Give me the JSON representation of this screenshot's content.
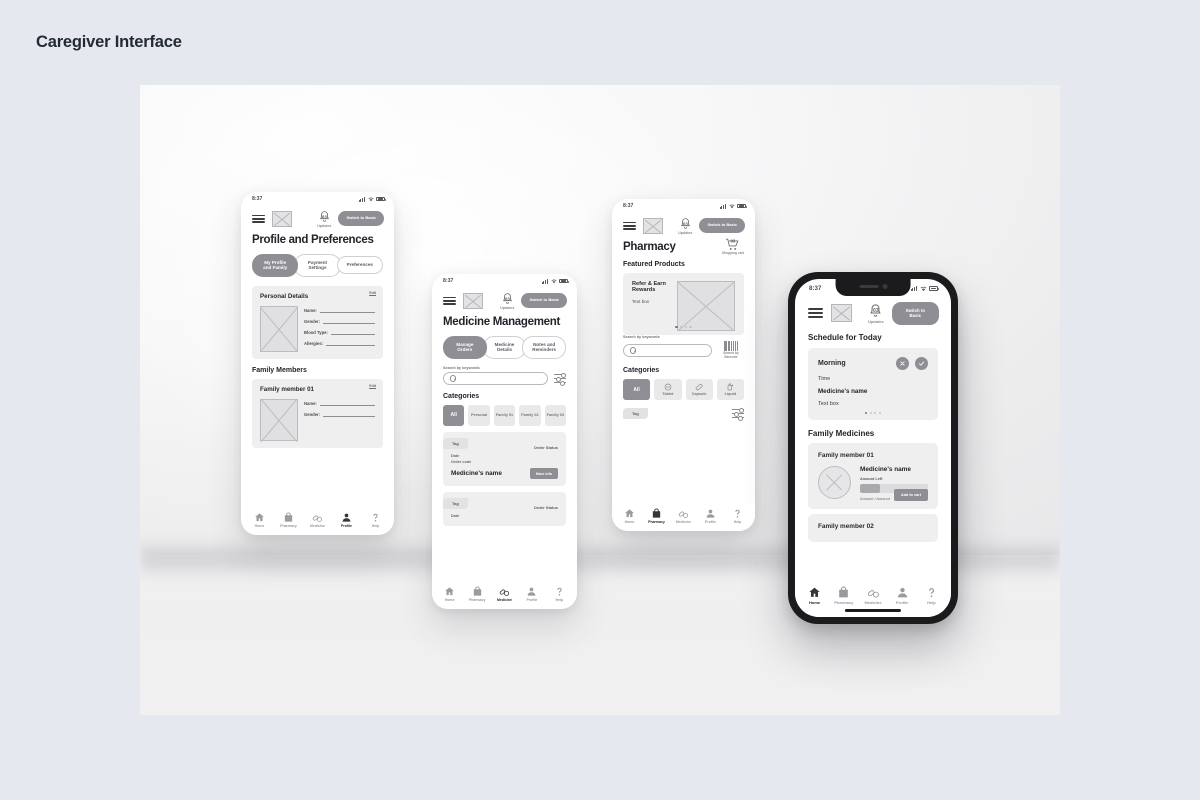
{
  "page": {
    "title": "Caregiver Interface"
  },
  "common": {
    "status_time": "8:37",
    "updates_label": "Updates",
    "updates_badge": "03",
    "switch_button": "Switch to Basic",
    "nav": [
      {
        "label": "Home",
        "icon": "home-icon"
      },
      {
        "label": "Pharmacy",
        "icon": "bag-icon"
      },
      {
        "label": "Medicine",
        "icon": "pills-icon"
      },
      {
        "label": "Profile",
        "icon": "person-icon"
      },
      {
        "label": "Help",
        "icon": "question-icon"
      }
    ],
    "edit_link": "Edit"
  },
  "screen1": {
    "title": "Profile and Preferences",
    "tabs": [
      {
        "label": "My Profile and Family",
        "active": true
      },
      {
        "label": "Payment Settings",
        "active": false
      },
      {
        "label": "Preferences",
        "active": false
      }
    ],
    "personal_details": {
      "title": "Personal Details",
      "fields": [
        "Name:",
        "Gender:",
        "Blood Type:",
        "Allergies:"
      ]
    },
    "family_members_heading": "Family Members",
    "family_card": {
      "title": "Family member 01",
      "fields": [
        "Name:",
        "Gender:"
      ]
    },
    "active_nav": "Profile"
  },
  "screen2": {
    "title": "Medicine Management",
    "tabs": [
      {
        "label": "Manage Orders",
        "active": true
      },
      {
        "label": "Medicine Details",
        "active": false
      },
      {
        "label": "Notes and Reminders",
        "active": false
      }
    ],
    "search_label": "Search by keywords",
    "search_placeholder": "",
    "categories_heading": "Categories",
    "categories": [
      {
        "label": "All",
        "active": true
      },
      {
        "label": "Personal",
        "active": false
      },
      {
        "label": "Family 01",
        "active": false
      },
      {
        "label": "Family 02",
        "active": false
      },
      {
        "label": "Family 03",
        "active": false
      }
    ],
    "orders": [
      {
        "tag": "Tag",
        "status": "Order Status",
        "date": "Date",
        "code": "Order code",
        "name": "Medicine's name",
        "button": "More info"
      },
      {
        "tag": "Tag",
        "status": "Order Status",
        "date": "Date",
        "code": "",
        "name": "",
        "button": ""
      }
    ],
    "active_nav": "Medicine"
  },
  "screen3": {
    "title": "Pharmacy",
    "cart_label": "Shopping cart",
    "cart_badge": "03",
    "featured_heading": "Featured Products",
    "featured": {
      "title": "Refer & Earn Rewards",
      "subtitle": "Text box",
      "dots": 4,
      "active_dot": 0
    },
    "search_label": "Search by keywords",
    "barcode_label": "Search by Barcode",
    "categories_heading": "Categories",
    "categories": [
      {
        "label": "All",
        "active": true,
        "icon": "none"
      },
      {
        "label": "Tablet",
        "active": false,
        "icon": "tablet-icon"
      },
      {
        "label": "Capsule",
        "active": false,
        "icon": "capsule-icon"
      },
      {
        "label": "Liquid",
        "active": false,
        "icon": "bottle-icon"
      }
    ],
    "list_tag": "Tag",
    "active_nav": "Pharmacy"
  },
  "screen4": {
    "title": "Schedule for Today",
    "schedule": {
      "period": "Morning",
      "time": "Time",
      "medicine": "Medicine's name",
      "note": "Text box",
      "dots": 4,
      "active_dot": 0,
      "dismiss_icon": "close-icon",
      "confirm_icon": "check-icon"
    },
    "family_medicines_heading": "Family Medicines",
    "members": [
      {
        "title": "Family member 01",
        "medicine": "Medicine's name",
        "amount_label": "Amount Left",
        "amount_value": "Amount / Amount",
        "button": "Add to cart"
      },
      {
        "title": "Family member 02",
        "medicine": "",
        "amount_label": "",
        "amount_value": "",
        "button": ""
      }
    ],
    "active_nav": "Home"
  }
}
